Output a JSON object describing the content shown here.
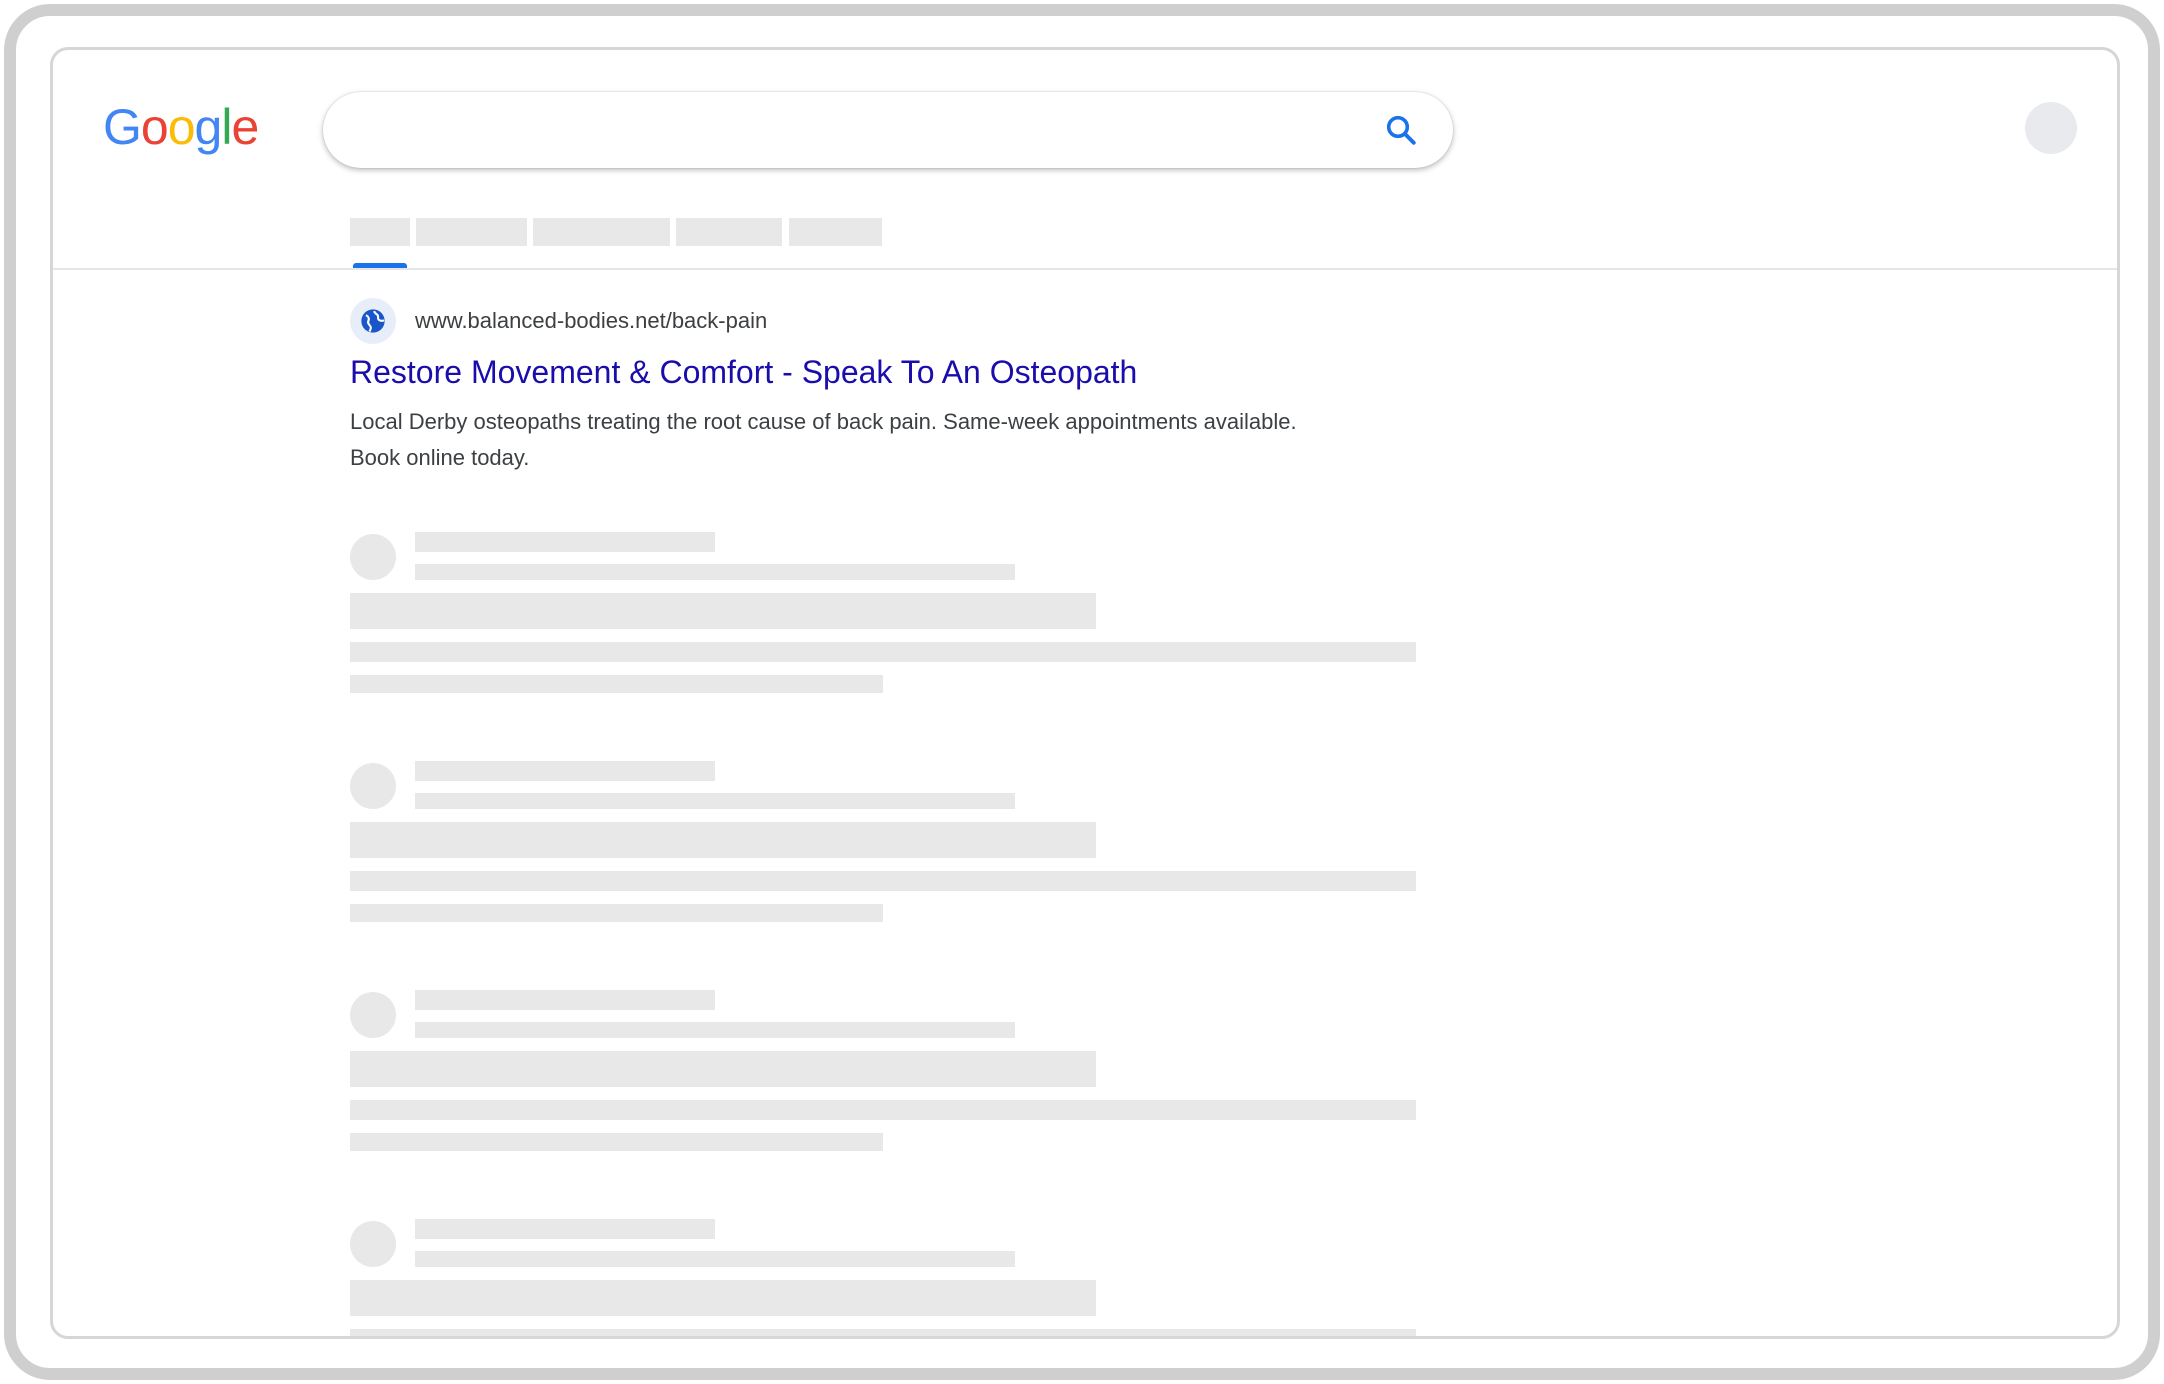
{
  "header": {
    "logo_letters": [
      {
        "char": "G",
        "color": "#4285F4"
      },
      {
        "char": "o",
        "color": "#EA4335"
      },
      {
        "char": "o",
        "color": "#FBBC05"
      },
      {
        "char": "g",
        "color": "#4285F4"
      },
      {
        "char": "l",
        "color": "#34A853"
      },
      {
        "char": "e",
        "color": "#EA4335"
      }
    ],
    "search": {
      "value": "",
      "placeholder": ""
    },
    "icon": "search-icon",
    "accent_color": "#1a73e8"
  },
  "ad_result": {
    "icon": "globe-icon",
    "url": "www.balanced-bodies.net/back-pain",
    "title": "Restore Movement & Comfort - Speak To An Osteopath",
    "description": "Local Derby osteopaths treating the root cause of back pain. Same-week appointments available. Book online today.",
    "title_color": "#1a0dab"
  },
  "placeholder_color": "#e8e8e8"
}
